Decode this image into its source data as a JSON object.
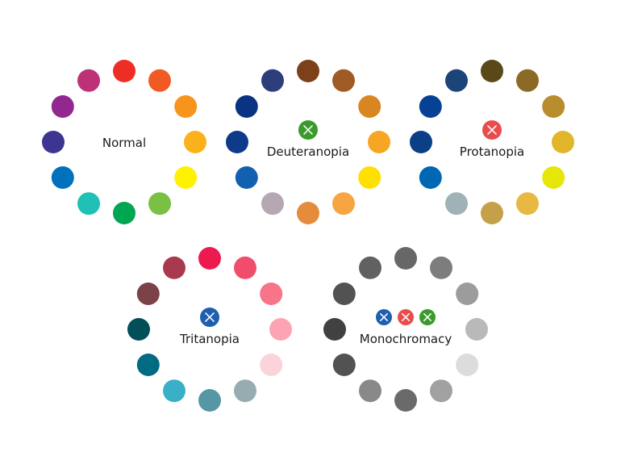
{
  "wheels": [
    {
      "id": "normal",
      "label": "Normal",
      "icons": [],
      "dots": [
        "#ee2d24",
        "#f15a24",
        "#f7941d",
        "#fbb21a",
        "#fff200",
        "#7ac143",
        "#00a651",
        "#20c0b4",
        "#0071bc",
        "#3c3592",
        "#92278f",
        "#be3178"
      ]
    },
    {
      "id": "deuteranopia",
      "label": "Deuteranopia",
      "icons": [
        {
          "name": "x-icon",
          "color": "#3a9a2c"
        }
      ],
      "dots": [
        "#7c401a",
        "#a05a24",
        "#d98622",
        "#f6a623",
        "#ffe000",
        "#f7a541",
        "#e58b3c",
        "#b6a8b3",
        "#1460b0",
        "#0f3a8a",
        "#0c3383",
        "#2c3e7b"
      ]
    },
    {
      "id": "protanopia",
      "label": "Protanopia",
      "icons": [
        {
          "name": "x-icon",
          "color": "#e84c4c"
        }
      ],
      "dots": [
        "#5a4818",
        "#8a6a24",
        "#b98c2e",
        "#e2b62a",
        "#e6e609",
        "#e9b842",
        "#c69f4a",
        "#9fb2b8",
        "#0068b3",
        "#0b3f86",
        "#074196",
        "#1b4578"
      ]
    },
    {
      "id": "tritanopia",
      "label": "Tritanopia",
      "icons": [
        {
          "name": "x-icon",
          "color": "#1f5fb0"
        }
      ],
      "dots": [
        "#ec1a4e",
        "#f04d6c",
        "#f77489",
        "#fda4b2",
        "#fcd3da",
        "#97acb0",
        "#5796a4",
        "#3ab0c6",
        "#016b83",
        "#024f57",
        "#7b4247",
        "#a93a4e"
      ]
    },
    {
      "id": "monochromacy",
      "label": "Monochromacy",
      "icons": [
        {
          "name": "x-icon",
          "color": "#1f5fb0"
        },
        {
          "name": "x-icon",
          "color": "#e84c4c"
        },
        {
          "name": "x-icon",
          "color": "#3a9a2c"
        }
      ],
      "dots": [
        "#676767",
        "#7d7d7d",
        "#9c9c9c",
        "#b9b9b9",
        "#dcdcdc",
        "#a1a1a1",
        "#6a6a6a",
        "#898989",
        "#525252",
        "#414141",
        "#525252",
        "#616161"
      ]
    }
  ]
}
